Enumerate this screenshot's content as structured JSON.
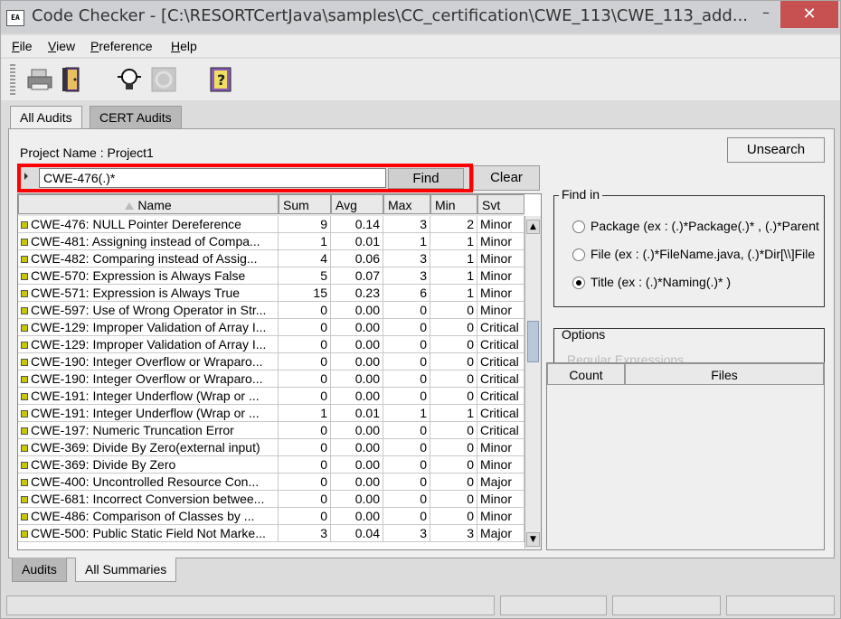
{
  "window": {
    "title": "Code Checker - [C:\\RESORTCertJava\\samples\\CC_certification\\CWE_113\\CWE_113_add...",
    "app_icon_text": "EA",
    "minimize_label": "–",
    "close_label": "✕"
  },
  "menu": {
    "items": [
      {
        "first": "F",
        "rest": "ile"
      },
      {
        "first": "V",
        "rest": "iew"
      },
      {
        "first": "P",
        "rest": "reference"
      },
      {
        "first": "H",
        "rest": "elp"
      }
    ]
  },
  "toolbar": {
    "icons": [
      "print-icon",
      "exit-door-icon",
      "audit-bulb-icon",
      "disabled-tool-icon",
      "help-book-icon"
    ]
  },
  "top_tabs": [
    {
      "label": "All Audits",
      "active": true
    },
    {
      "label": "CERT Audits",
      "active": false
    }
  ],
  "project": {
    "label": "Project Name : Project1"
  },
  "buttons": {
    "unsearch": "Unsearch",
    "find": "Find",
    "clear": "Clear"
  },
  "search": {
    "value": "CWE-476(.)*"
  },
  "table": {
    "columns": [
      "Name",
      "Sum",
      "Avg",
      "Max",
      "Min",
      "Svt"
    ],
    "rows": [
      {
        "name": "CWE-476: NULL Pointer Dereference",
        "sum": "9",
        "avg": "0.14",
        "max": "3",
        "min": "2",
        "svt": "Minor"
      },
      {
        "name": "CWE-481: Assigning instead of Compa...",
        "sum": "1",
        "avg": "0.01",
        "max": "1",
        "min": "1",
        "svt": "Minor"
      },
      {
        "name": "CWE-482: Comparing instead of Assig...",
        "sum": "4",
        "avg": "0.06",
        "max": "3",
        "min": "1",
        "svt": "Minor"
      },
      {
        "name": "CWE-570: Expression is Always False",
        "sum": "5",
        "avg": "0.07",
        "max": "3",
        "min": "1",
        "svt": "Minor"
      },
      {
        "name": "CWE-571: Expression is Always True",
        "sum": "15",
        "avg": "0.23",
        "max": "6",
        "min": "1",
        "svt": "Minor"
      },
      {
        "name": "CWE-597: Use of Wrong Operator in Str...",
        "sum": "0",
        "avg": "0.00",
        "max": "0",
        "min": "0",
        "svt": "Minor"
      },
      {
        "name": "CWE-129: Improper Validation of Array I...",
        "sum": "0",
        "avg": "0.00",
        "max": "0",
        "min": "0",
        "svt": "Critical"
      },
      {
        "name": "CWE-129: Improper Validation of Array I...",
        "sum": "0",
        "avg": "0.00",
        "max": "0",
        "min": "0",
        "svt": "Critical"
      },
      {
        "name": "CWE-190: Integer Overflow or Wraparo...",
        "sum": "0",
        "avg": "0.00",
        "max": "0",
        "min": "0",
        "svt": "Critical"
      },
      {
        "name": "CWE-190: Integer Overflow or Wraparo...",
        "sum": "0",
        "avg": "0.00",
        "max": "0",
        "min": "0",
        "svt": "Critical"
      },
      {
        "name": "CWE-191: Integer Underflow (Wrap or ...",
        "sum": "0",
        "avg": "0.00",
        "max": "0",
        "min": "0",
        "svt": "Critical"
      },
      {
        "name": "CWE-191: Integer Underflow (Wrap or ...",
        "sum": "1",
        "avg": "0.01",
        "max": "1",
        "min": "1",
        "svt": "Critical"
      },
      {
        "name": "CWE-197: Numeric Truncation Error",
        "sum": "0",
        "avg": "0.00",
        "max": "0",
        "min": "0",
        "svt": "Critical"
      },
      {
        "name": "CWE-369: Divide By Zero(external input)",
        "sum": "0",
        "avg": "0.00",
        "max": "0",
        "min": "0",
        "svt": "Minor"
      },
      {
        "name": "CWE-369: Divide By Zero",
        "sum": "0",
        "avg": "0.00",
        "max": "0",
        "min": "0",
        "svt": "Minor"
      },
      {
        "name": "CWE-400: Uncontrolled Resource Con...",
        "sum": "0",
        "avg": "0.00",
        "max": "0",
        "min": "0",
        "svt": "Major"
      },
      {
        "name": "CWE-681: Incorrect Conversion betwee...",
        "sum": "0",
        "avg": "0.00",
        "max": "0",
        "min": "0",
        "svt": "Minor"
      },
      {
        "name": "CWE-486: Comparison of Classes by ...",
        "sum": "0",
        "avg": "0.00",
        "max": "0",
        "min": "0",
        "svt": "Minor"
      },
      {
        "name": "CWE-500: Public Static Field Not Marke...",
        "sum": "3",
        "avg": "0.04",
        "max": "3",
        "min": "3",
        "svt": "Major"
      }
    ]
  },
  "find_in": {
    "legend": "Find in",
    "options": [
      {
        "label": "Package (ex : (.)*Package(.)* ,  (.)*Parent",
        "checked": false
      },
      {
        "label": "File (ex : (.)*FileName.java, (.)*Dir[\\\\]File",
        "checked": false
      },
      {
        "label": "Title (ex : (.)*Naming(.)* )",
        "checked": true
      }
    ]
  },
  "options": {
    "legend": "Options",
    "regex_label": "Regular Expressions"
  },
  "count_table": {
    "columns": [
      "Count",
      "Files"
    ]
  },
  "bottom_tabs": [
    {
      "label": "Audits",
      "active": false
    },
    {
      "label": "All Summaries",
      "active": true
    }
  ]
}
